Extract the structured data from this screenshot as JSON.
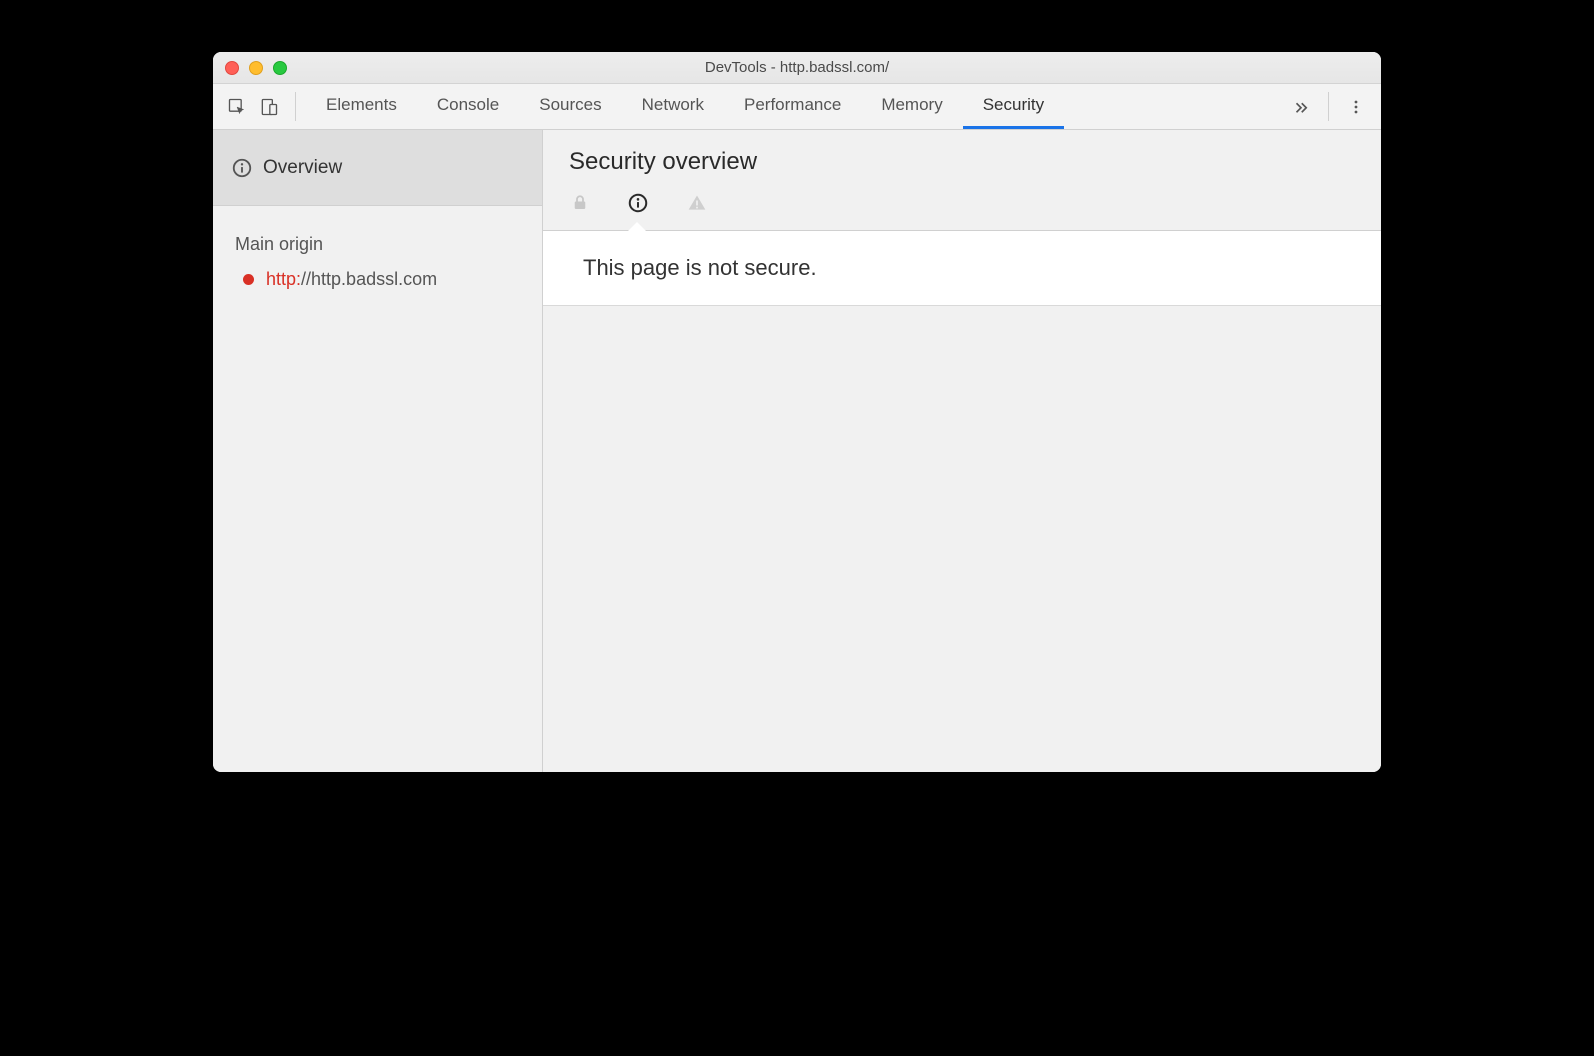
{
  "window": {
    "title": "DevTools - http.badssl.com/"
  },
  "tabs": {
    "items": [
      {
        "label": "Elements",
        "active": false
      },
      {
        "label": "Console",
        "active": false
      },
      {
        "label": "Sources",
        "active": false
      },
      {
        "label": "Network",
        "active": false
      },
      {
        "label": "Performance",
        "active": false
      },
      {
        "label": "Memory",
        "active": false
      },
      {
        "label": "Security",
        "active": true
      }
    ]
  },
  "sidebar": {
    "overview_label": "Overview",
    "section_label": "Main origin",
    "origin": {
      "scheme": "http:",
      "host": "//http.badssl.com",
      "status_color": "#d93025"
    }
  },
  "main": {
    "title": "Security overview",
    "notice": "This page is not secure."
  }
}
